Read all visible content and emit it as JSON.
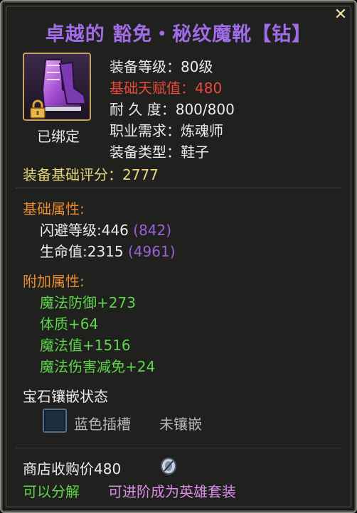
{
  "tooltip": {
    "title": "卓越的 豁免・秘纹魔靴【钻】",
    "bound_status": "已绑定",
    "info": {
      "level": "装备等级：80级",
      "talent": "基础天赋值：480",
      "durability": "耐 久 度：800/800",
      "class_req": "职业需求：炼魂师",
      "type": "装备类型：鞋子"
    },
    "base_score": "装备基础评分：2777",
    "base_attr": {
      "header": "基础属性:",
      "dodge": {
        "label": "闪避等级:446",
        "bonus": "(842)"
      },
      "hp": {
        "label": "生命值:2315",
        "bonus": "(4961)"
      }
    },
    "extra_attr": {
      "header": "附加属性:",
      "items": [
        "魔法防御+273",
        "体质+64",
        "魔法值+1516",
        "魔法伤害减免+24"
      ]
    },
    "gem": {
      "header": "宝石镶嵌状态",
      "slot_color": "蓝色插槽",
      "slot_status": "未镶嵌"
    },
    "shop_price": "商店收购价480",
    "can_decompose": "可以分解",
    "can_upgrade": "可进阶成为英雄套装"
  },
  "colors": {
    "title": "#a06ce8",
    "talent": "#e84a3a",
    "score": "#e8d77e",
    "header": "#e78b32",
    "extra": "#5ed64c",
    "bonus": "#9b62d8"
  },
  "icons": {
    "item": "purple-boots-icon",
    "lock": "lock-icon",
    "close": "close-icon",
    "coin": "silver-coin-icon",
    "slot": "gem-slot-icon"
  }
}
